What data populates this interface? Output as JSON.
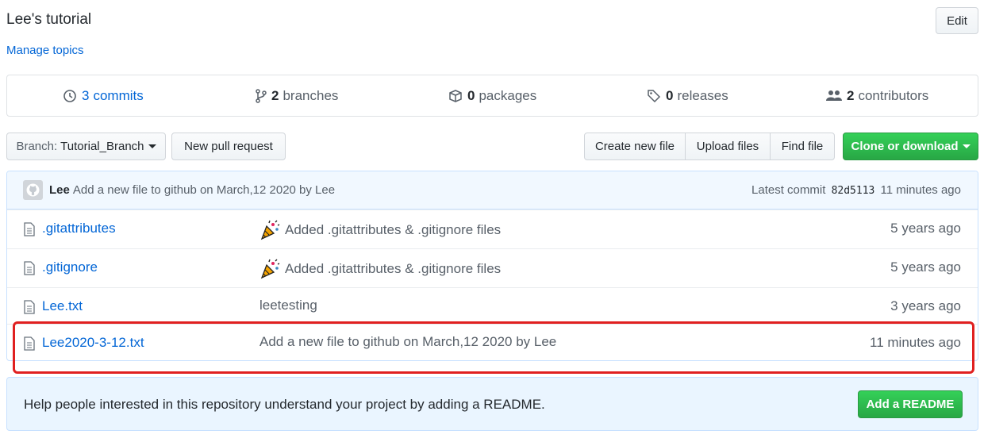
{
  "repo": {
    "title": "Lee's tutorial",
    "manage_topics": "Manage topics",
    "edit_label": "Edit"
  },
  "summary": {
    "commits": {
      "count": "3",
      "label": "commits"
    },
    "branches": {
      "count": "2",
      "label": "branches"
    },
    "packages": {
      "count": "0",
      "label": "packages"
    },
    "releases": {
      "count": "0",
      "label": "releases"
    },
    "contributors": {
      "count": "2",
      "label": "contributors"
    }
  },
  "toolbar": {
    "branch_prefix": "Branch:",
    "branch_name": "Tutorial_Branch",
    "new_pull_request": "New pull request",
    "create_new_file": "Create new file",
    "upload_files": "Upload files",
    "find_file": "Find file",
    "clone_or_download": "Clone or download"
  },
  "latest_commit": {
    "author": "Lee",
    "message": "Add a new file to github on March,12 2020 by Lee",
    "prefix": "Latest commit",
    "sha": "82d5113",
    "age": "11 minutes ago"
  },
  "files": [
    {
      "name": ".gitattributes",
      "message": "Added .gitattributes & .gitignore files",
      "age": "5 years ago"
    },
    {
      "name": ".gitignore",
      "message": "Added .gitattributes & .gitignore files",
      "age": "5 years ago"
    },
    {
      "name": "Lee.txt",
      "message": "leetesting",
      "age": "3 years ago"
    },
    {
      "name": "Lee2020-3-12.txt",
      "message": "Add a new file to github on March,12 2020 by Lee",
      "age": "11 minutes ago"
    }
  ],
  "readme": {
    "text": "Help people interested in this repository understand your project by adding a README.",
    "button": "Add a README"
  },
  "colors": {
    "link": "#0366d6",
    "primary_green": "#28a745",
    "highlight_red": "#e02020"
  }
}
